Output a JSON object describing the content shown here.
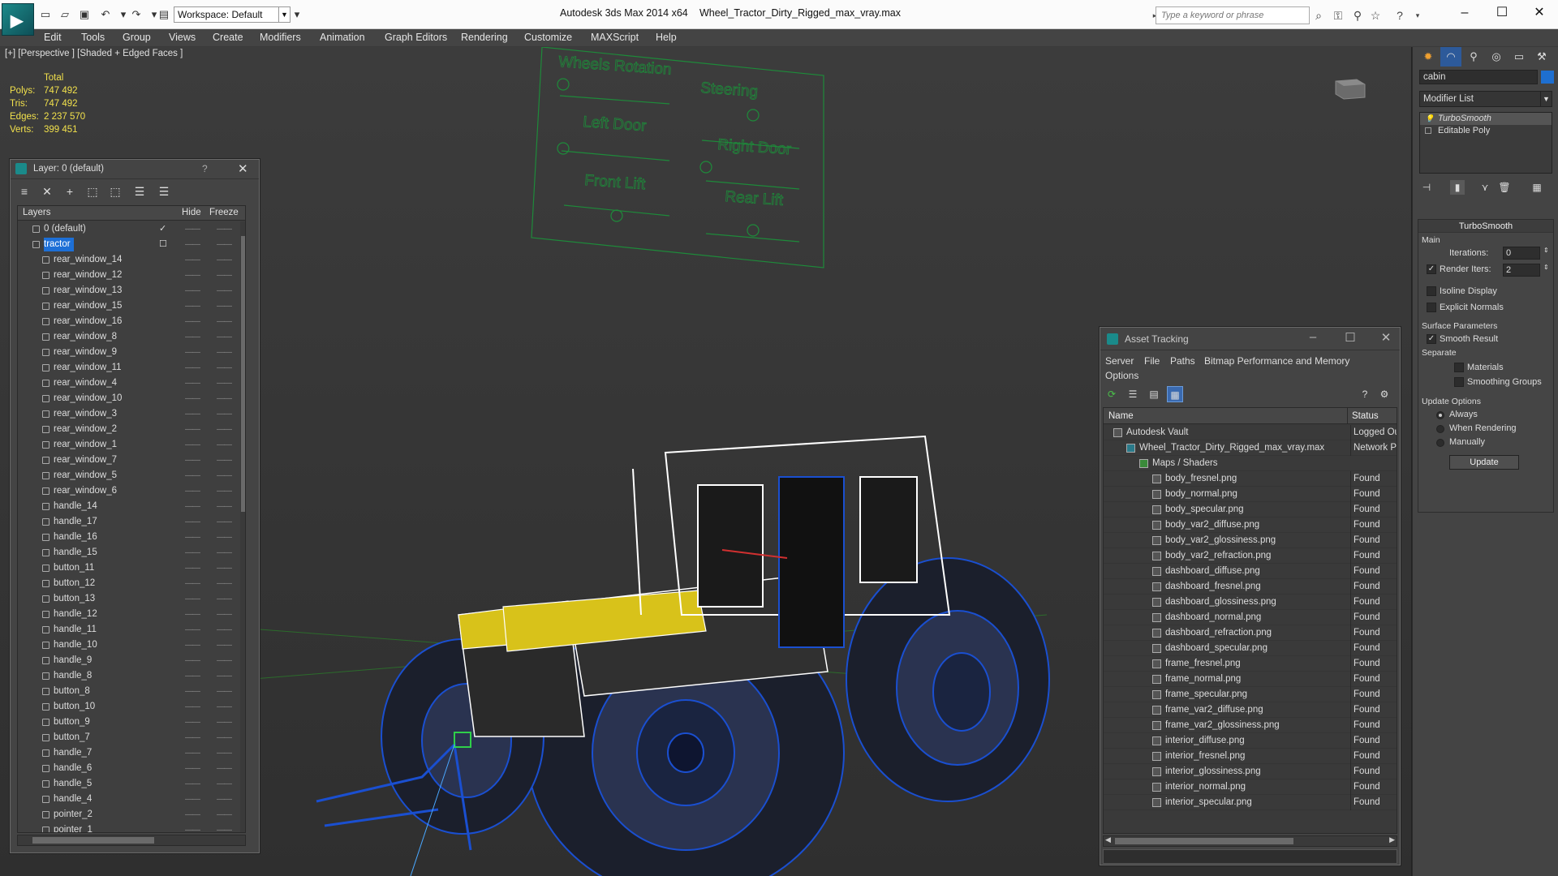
{
  "titlebar": {
    "workspace": "Workspace: Default",
    "app_title": "Autodesk 3ds Max  2014 x64",
    "file_title": "Wheel_Tractor_Dirty_Rigged_max_vray.max",
    "search_placeholder": "Type a keyword or phrase"
  },
  "menu": [
    "Edit",
    "Tools",
    "Group",
    "Views",
    "Create",
    "Modifiers",
    "Animation",
    "Graph Editors",
    "Rendering",
    "Customize",
    "MAXScript",
    "Help"
  ],
  "viewport": {
    "label": "[+] [Perspective ] [Shaded + Edged Faces ]",
    "stats": {
      "header": "Total",
      "rows": [
        {
          "k": "Polys:",
          "v": "747 492"
        },
        {
          "k": "Tris:",
          "v": "747 492"
        },
        {
          "k": "Edges:",
          "v": "2 237 570"
        },
        {
          "k": "Verts:",
          "v": "399 451"
        }
      ]
    },
    "rig_labels": {
      "wheels_rotation": "Wheels Rotation",
      "steering": "Steering",
      "left_door": "Left Door",
      "right_door": "Right Door",
      "front_lift": "Front Lift",
      "rear_lift": "Rear Lift"
    },
    "colors": {
      "wire_white": "#ffffff",
      "wire_blue": "#1a4fd0",
      "wire_yellow": "#d8c21a",
      "rig_green": "#1e8a3a"
    }
  },
  "layer_dialog": {
    "title": "Layer: 0 (default)",
    "help": "?",
    "headers": {
      "layers": "Layers",
      "hide": "Hide",
      "freeze": "Freeze"
    },
    "rows": [
      {
        "name": "0 (default)",
        "level": 0,
        "mark": "check"
      },
      {
        "name": "tractor",
        "level": 0,
        "selected": true,
        "mark": "box"
      },
      {
        "name": "rear_window_14",
        "level": 1
      },
      {
        "name": "rear_window_12",
        "level": 1
      },
      {
        "name": "rear_window_13",
        "level": 1
      },
      {
        "name": "rear_window_15",
        "level": 1
      },
      {
        "name": "rear_window_16",
        "level": 1
      },
      {
        "name": "rear_window_8",
        "level": 1
      },
      {
        "name": "rear_window_9",
        "level": 1
      },
      {
        "name": "rear_window_11",
        "level": 1
      },
      {
        "name": "rear_window_4",
        "level": 1
      },
      {
        "name": "rear_window_10",
        "level": 1
      },
      {
        "name": "rear_window_3",
        "level": 1
      },
      {
        "name": "rear_window_2",
        "level": 1
      },
      {
        "name": "rear_window_1",
        "level": 1
      },
      {
        "name": "rear_window_7",
        "level": 1
      },
      {
        "name": "rear_window_5",
        "level": 1
      },
      {
        "name": "rear_window_6",
        "level": 1
      },
      {
        "name": "handle_14",
        "level": 1
      },
      {
        "name": "handle_17",
        "level": 1
      },
      {
        "name": "handle_16",
        "level": 1
      },
      {
        "name": "handle_15",
        "level": 1
      },
      {
        "name": "button_11",
        "level": 1
      },
      {
        "name": "button_12",
        "level": 1
      },
      {
        "name": "button_13",
        "level": 1
      },
      {
        "name": "handle_12",
        "level": 1
      },
      {
        "name": "handle_11",
        "level": 1
      },
      {
        "name": "handle_10",
        "level": 1
      },
      {
        "name": "handle_9",
        "level": 1
      },
      {
        "name": "handle_8",
        "level": 1
      },
      {
        "name": "button_8",
        "level": 1
      },
      {
        "name": "button_10",
        "level": 1
      },
      {
        "name": "button_9",
        "level": 1
      },
      {
        "name": "button_7",
        "level": 1
      },
      {
        "name": "handle_7",
        "level": 1
      },
      {
        "name": "handle_6",
        "level": 1
      },
      {
        "name": "handle_5",
        "level": 1
      },
      {
        "name": "handle_4",
        "level": 1
      },
      {
        "name": "pointer_2",
        "level": 1
      },
      {
        "name": "pointer_1",
        "level": 1
      }
    ]
  },
  "command_panel": {
    "object_name": "cabin",
    "object_color": "#1e6fd0",
    "modifier_list": "Modifier List",
    "stack": [
      "TurboSmooth",
      "Editable Poly"
    ],
    "turbosmooth": {
      "title": "TurboSmooth",
      "main": "Main",
      "iterations_label": "Iterations:",
      "iterations": "0",
      "render_iters_label": "Render Iters:",
      "render_iters": "2",
      "isoline": "Isoline Display",
      "explicit": "Explicit Normals",
      "surface": "Surface Parameters",
      "smooth_result": "Smooth Result",
      "separate": "Separate",
      "materials": "Materials",
      "smoothing_groups": "Smoothing Groups",
      "update_options": "Update Options",
      "always": "Always",
      "when_rendering": "When Rendering",
      "manually": "Manually",
      "update": "Update"
    }
  },
  "asset_tracking": {
    "title": "Asset Tracking",
    "menu": [
      "Server",
      "File",
      "Paths",
      "Bitmap Performance and Memory",
      "Options"
    ],
    "headers": {
      "name": "Name",
      "status": "Status"
    },
    "rows": [
      {
        "name": "Autodesk Vault",
        "level": 0,
        "status": "Logged Ou"
      },
      {
        "name": "Wheel_Tractor_Dirty_Rigged_max_vray.max",
        "level": 1,
        "status": "Network P"
      },
      {
        "name": "Maps / Shaders",
        "level": 2,
        "status": ""
      },
      {
        "name": "body_fresnel.png",
        "level": 3,
        "status": "Found"
      },
      {
        "name": "body_normal.png",
        "level": 3,
        "status": "Found"
      },
      {
        "name": "body_specular.png",
        "level": 3,
        "status": "Found"
      },
      {
        "name": "body_var2_diffuse.png",
        "level": 3,
        "status": "Found"
      },
      {
        "name": "body_var2_glossiness.png",
        "level": 3,
        "status": "Found"
      },
      {
        "name": "body_var2_refraction.png",
        "level": 3,
        "status": "Found"
      },
      {
        "name": "dashboard_diffuse.png",
        "level": 3,
        "status": "Found"
      },
      {
        "name": "dashboard_fresnel.png",
        "level": 3,
        "status": "Found"
      },
      {
        "name": "dashboard_glossiness.png",
        "level": 3,
        "status": "Found"
      },
      {
        "name": "dashboard_normal.png",
        "level": 3,
        "status": "Found"
      },
      {
        "name": "dashboard_refraction.png",
        "level": 3,
        "status": "Found"
      },
      {
        "name": "dashboard_specular.png",
        "level": 3,
        "status": "Found"
      },
      {
        "name": "frame_fresnel.png",
        "level": 3,
        "status": "Found"
      },
      {
        "name": "frame_normal.png",
        "level": 3,
        "status": "Found"
      },
      {
        "name": "frame_specular.png",
        "level": 3,
        "status": "Found"
      },
      {
        "name": "frame_var2_diffuse.png",
        "level": 3,
        "status": "Found"
      },
      {
        "name": "frame_var2_glossiness.png",
        "level": 3,
        "status": "Found"
      },
      {
        "name": "interior_diffuse.png",
        "level": 3,
        "status": "Found"
      },
      {
        "name": "interior_fresnel.png",
        "level": 3,
        "status": "Found"
      },
      {
        "name": "interior_glossiness.png",
        "level": 3,
        "status": "Found"
      },
      {
        "name": "interior_normal.png",
        "level": 3,
        "status": "Found"
      },
      {
        "name": "interior_specular.png",
        "level": 3,
        "status": "Found"
      }
    ]
  }
}
